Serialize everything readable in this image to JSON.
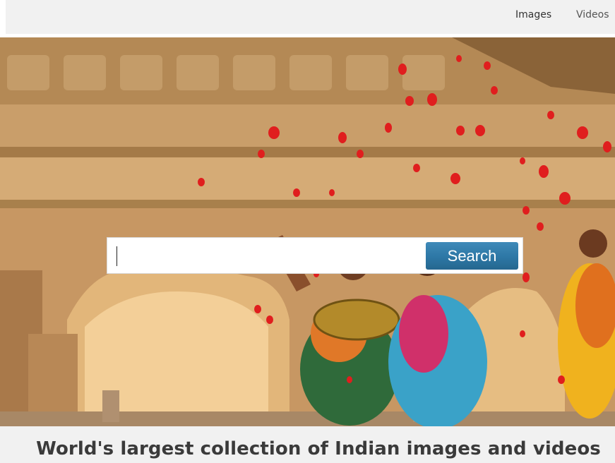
{
  "nav": {
    "images_label": "Images",
    "videos_label": "Videos"
  },
  "search": {
    "value": "",
    "placeholder": "",
    "button_label": "Search"
  },
  "hero": {
    "description_icon": "hero-photo"
  },
  "footer": {
    "tagline": "World's largest collection of Indian images and videos"
  },
  "colors": {
    "search_button": "#2d77a5",
    "topbar": "#f1f1f1",
    "tagline": "#3a3a3a"
  }
}
